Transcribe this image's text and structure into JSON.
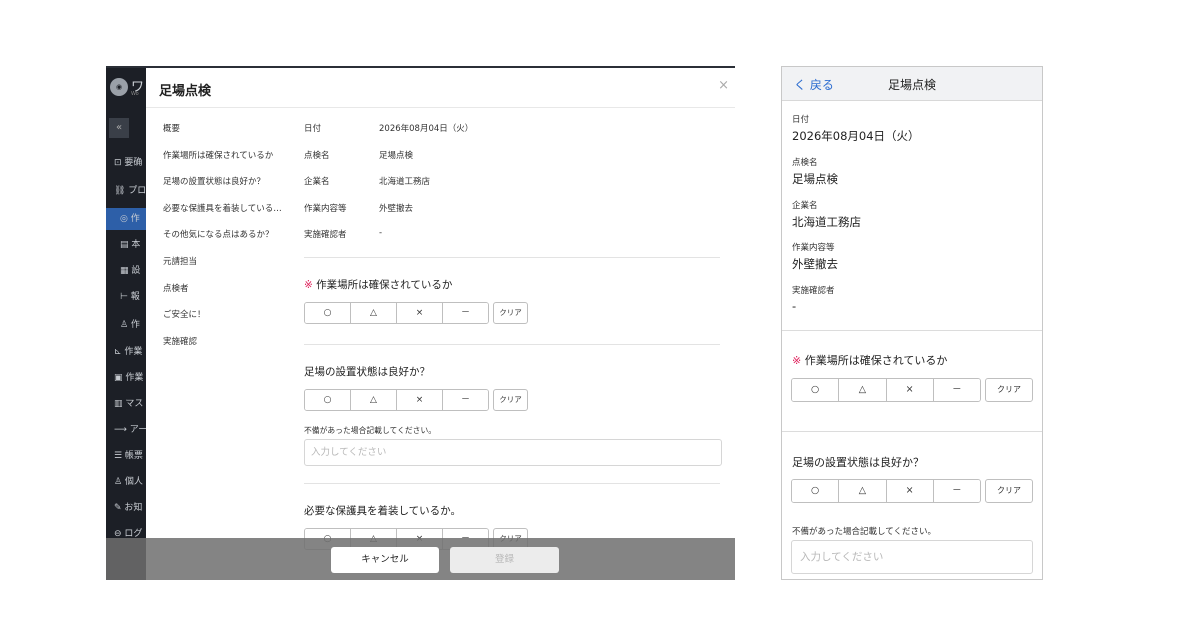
{
  "desktop": {
    "app_name": "ワ",
    "app_sub": "Wo",
    "collapse_icon": "«",
    "nav": [
      {
        "label": "⊡ 要确",
        "icon": "dashboard-icon"
      },
      {
        "label": "⛓ プロ",
        "icon": "project-icon"
      },
      {
        "label": "◎ 作",
        "icon": "work-icon"
      },
      {
        "label": "▤ 本",
        "icon": "list-icon"
      },
      {
        "label": "▦ 設",
        "icon": "settings-icon"
      },
      {
        "label": "⊢ 報",
        "icon": "report-icon"
      },
      {
        "label": "♙ 作",
        "icon": "user-icon"
      },
      {
        "label": "⊾ 作業",
        "icon": "chart-icon"
      },
      {
        "label": "▣ 作業",
        "icon": "calendar-icon"
      },
      {
        "label": "▥ マス",
        "icon": "master-icon"
      },
      {
        "label": "⟶ アー",
        "icon": "archive-icon"
      },
      {
        "label": "☰ 帳票",
        "icon": "form-icon"
      },
      {
        "label": "♙ 個人",
        "icon": "person-icon"
      },
      {
        "label": "✎ お知",
        "icon": "notice-icon"
      },
      {
        "label": "⊖ ログ",
        "icon": "logout-icon"
      }
    ],
    "modal_title": "足場点検",
    "close_icon": "×",
    "toc": [
      "概要",
      "作業場所は確保されているか",
      "足場の設置状態は良好か？",
      "必要な保護具を着装している…",
      "その他気になる点はあるか？",
      "元請担当",
      "点検者",
      "ご安全に！",
      "実施確認"
    ],
    "info": [
      {
        "label": "日付",
        "value": "2026年08月04日（火）"
      },
      {
        "label": "点検名",
        "value": "足場点検"
      },
      {
        "label": "企業名",
        "value": "北海道工務店"
      },
      {
        "label": "作業内容等",
        "value": "外壁撤去"
      },
      {
        "label": "実施確認者",
        "value": "-"
      }
    ],
    "required_mark": "※",
    "q1": "作業場所は確保されているか",
    "q2": "足場の設置状態は良好か？",
    "q3": "必要な保護具を着装しているか。",
    "options": [
      "○",
      "△",
      "×",
      "－"
    ],
    "clear_label": "クリア",
    "note_label": "不備があった場合記載してください。",
    "note_placeholder": "入力してください",
    "cancel_label": "キャンセル",
    "register_label": "登録"
  },
  "mobile": {
    "back_label": "く 戻る",
    "title": "足場点検",
    "fields": [
      {
        "label": "日付",
        "value": "2026年08月04日（火）"
      },
      {
        "label": "点検名",
        "value": "足場点検"
      },
      {
        "label": "企業名",
        "value": "北海道工務店"
      },
      {
        "label": "作業内容等",
        "value": "外壁撤去"
      },
      {
        "label": "実施確認者",
        "value": "-"
      }
    ],
    "required_mark": "※",
    "q1": "作業場所は確保されているか",
    "q2": "足場の設置状態は良好か？",
    "options": [
      "○",
      "△",
      "×",
      "－"
    ],
    "clear_label": "クリア",
    "note_label": "不備があった場合記載してください。",
    "note_placeholder": "入力してください"
  },
  "colors": {
    "required": "#e0245e",
    "link": "#2b6cd0",
    "sidebar_active": "#2d5fa8"
  }
}
